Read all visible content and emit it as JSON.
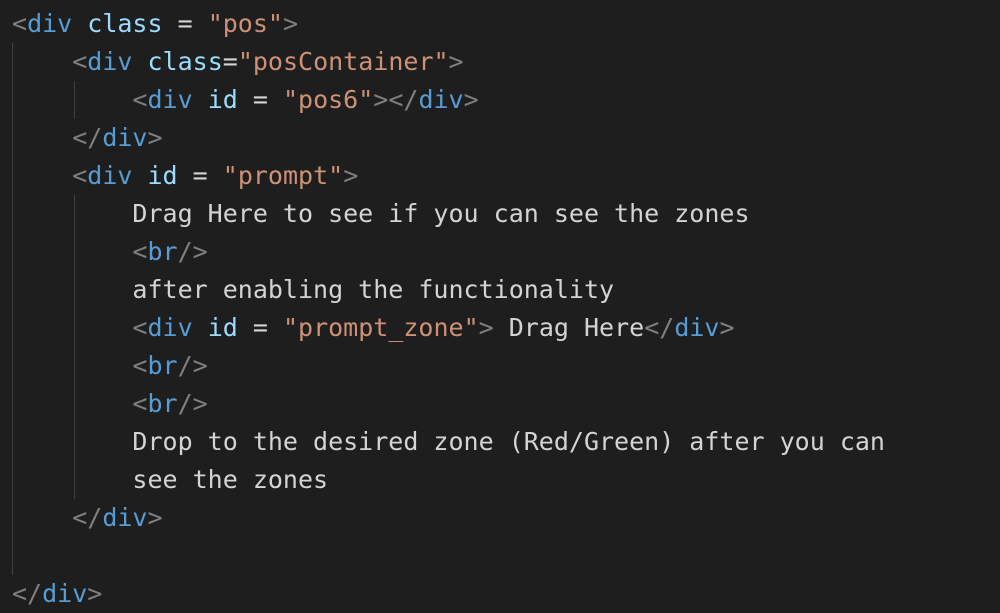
{
  "editor": {
    "language": "html",
    "colors": {
      "background": "#1e1e1e",
      "punctuation": "#808080",
      "tag": "#569cd6",
      "attribute": "#9cdcfe",
      "string": "#ce9178",
      "text": "#d4d4d4",
      "indent_guide": "#404040"
    },
    "lines": [
      {
        "tokens": [
          {
            "kind": "punct",
            "text": "<"
          },
          {
            "kind": "tag",
            "text": "div"
          },
          {
            "kind": "text",
            "text": " "
          },
          {
            "kind": "attr",
            "text": "class"
          },
          {
            "kind": "text",
            "text": " = "
          },
          {
            "kind": "str",
            "text": "\"pos\""
          },
          {
            "kind": "punct",
            "text": ">"
          }
        ]
      },
      {
        "tokens": [
          {
            "kind": "text",
            "text": "    "
          },
          {
            "kind": "punct",
            "text": "<"
          },
          {
            "kind": "tag",
            "text": "div"
          },
          {
            "kind": "text",
            "text": " "
          },
          {
            "kind": "attr",
            "text": "class"
          },
          {
            "kind": "text",
            "text": "="
          },
          {
            "kind": "str",
            "text": "\"posContainer\""
          },
          {
            "kind": "punct",
            "text": ">"
          }
        ]
      },
      {
        "tokens": [
          {
            "kind": "text",
            "text": "        "
          },
          {
            "kind": "punct",
            "text": "<"
          },
          {
            "kind": "tag",
            "text": "div"
          },
          {
            "kind": "text",
            "text": " "
          },
          {
            "kind": "attr",
            "text": "id"
          },
          {
            "kind": "text",
            "text": " = "
          },
          {
            "kind": "str",
            "text": "\"pos6\""
          },
          {
            "kind": "punct",
            "text": "></"
          },
          {
            "kind": "tag",
            "text": "div"
          },
          {
            "kind": "punct",
            "text": ">"
          }
        ]
      },
      {
        "tokens": [
          {
            "kind": "text",
            "text": "    "
          },
          {
            "kind": "punct",
            "text": "</"
          },
          {
            "kind": "tag",
            "text": "div"
          },
          {
            "kind": "punct",
            "text": ">"
          }
        ]
      },
      {
        "tokens": [
          {
            "kind": "text",
            "text": "    "
          },
          {
            "kind": "punct",
            "text": "<"
          },
          {
            "kind": "tag",
            "text": "div"
          },
          {
            "kind": "text",
            "text": " "
          },
          {
            "kind": "attr",
            "text": "id"
          },
          {
            "kind": "text",
            "text": " = "
          },
          {
            "kind": "str",
            "text": "\"prompt\""
          },
          {
            "kind": "punct",
            "text": ">"
          }
        ]
      },
      {
        "tokens": [
          {
            "kind": "text",
            "text": "        Drag Here to see if you can see the zones"
          }
        ]
      },
      {
        "tokens": [
          {
            "kind": "text",
            "text": "        "
          },
          {
            "kind": "punct",
            "text": "<"
          },
          {
            "kind": "tag",
            "text": "br"
          },
          {
            "kind": "punct",
            "text": "/>"
          }
        ]
      },
      {
        "tokens": [
          {
            "kind": "text",
            "text": "        after enabling the functionality"
          }
        ]
      },
      {
        "tokens": [
          {
            "kind": "text",
            "text": "        "
          },
          {
            "kind": "punct",
            "text": "<"
          },
          {
            "kind": "tag",
            "text": "div"
          },
          {
            "kind": "text",
            "text": " "
          },
          {
            "kind": "attr",
            "text": "id"
          },
          {
            "kind": "text",
            "text": " = "
          },
          {
            "kind": "str",
            "text": "\"prompt_zone\""
          },
          {
            "kind": "punct",
            "text": ">"
          },
          {
            "kind": "text",
            "text": " Drag Here"
          },
          {
            "kind": "punct",
            "text": "</"
          },
          {
            "kind": "tag",
            "text": "div"
          },
          {
            "kind": "punct",
            "text": ">"
          }
        ]
      },
      {
        "tokens": [
          {
            "kind": "text",
            "text": "        "
          },
          {
            "kind": "punct",
            "text": "<"
          },
          {
            "kind": "tag",
            "text": "br"
          },
          {
            "kind": "punct",
            "text": "/>"
          }
        ]
      },
      {
        "tokens": [
          {
            "kind": "text",
            "text": "        "
          },
          {
            "kind": "punct",
            "text": "<"
          },
          {
            "kind": "tag",
            "text": "br"
          },
          {
            "kind": "punct",
            "text": "/>"
          }
        ]
      },
      {
        "tokens": [
          {
            "kind": "text",
            "text": "        Drop to the desired zone (Red/Green) after you can"
          }
        ]
      },
      {
        "tokens": [
          {
            "kind": "text",
            "text": "        see the zones"
          }
        ]
      },
      {
        "tokens": [
          {
            "kind": "text",
            "text": "    "
          },
          {
            "kind": "punct",
            "text": "</"
          },
          {
            "kind": "tag",
            "text": "div"
          },
          {
            "kind": "punct",
            "text": ">"
          }
        ]
      },
      {
        "tokens": []
      },
      {
        "tokens": [
          {
            "kind": "punct",
            "text": "</"
          },
          {
            "kind": "tag",
            "text": "div"
          },
          {
            "kind": "punct",
            "text": ">"
          }
        ]
      }
    ]
  }
}
